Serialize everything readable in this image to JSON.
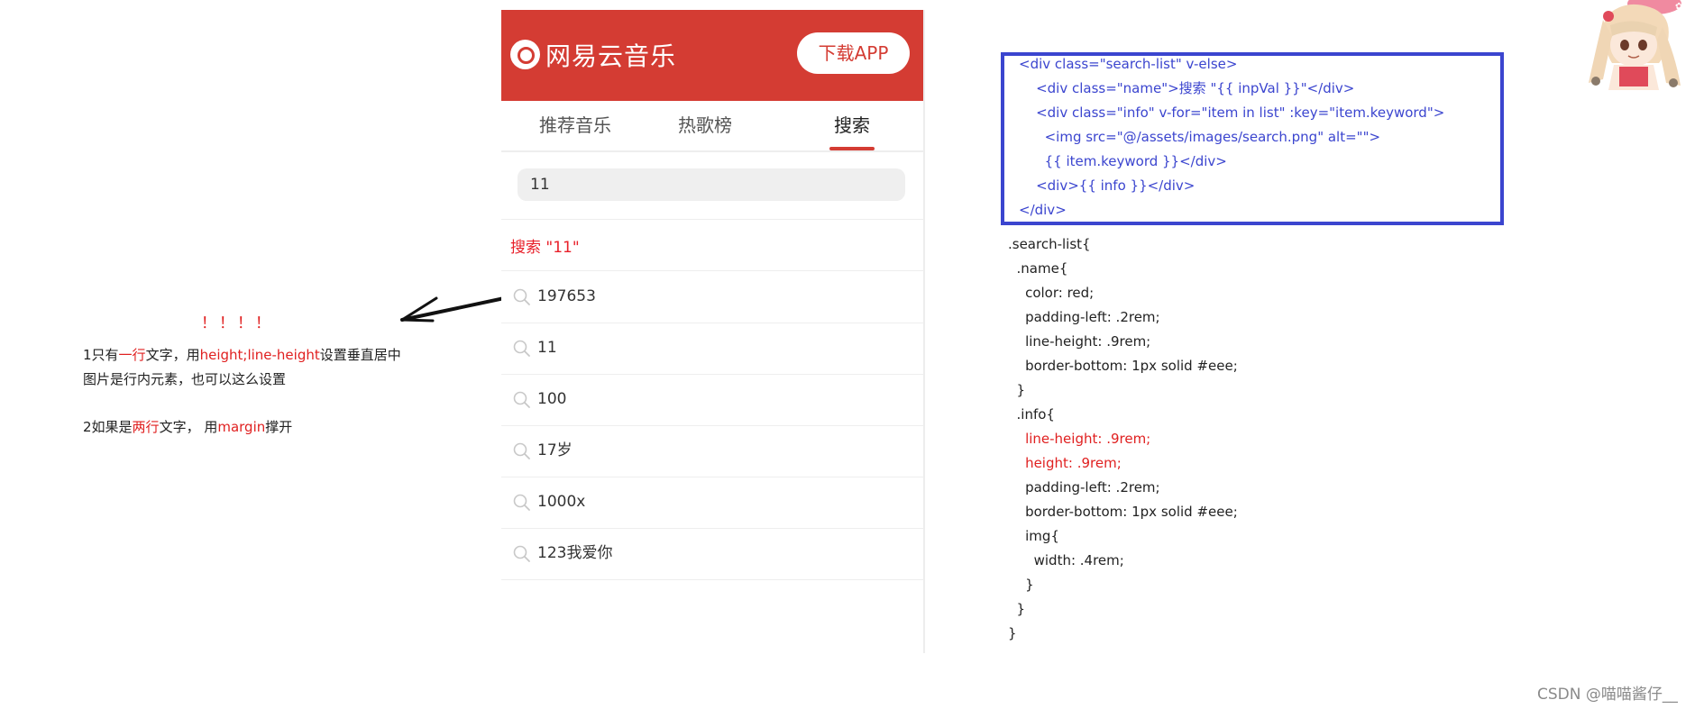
{
  "notes": {
    "exclaim": "！！！！",
    "line1_parts": [
      "1只有",
      "一行",
      "文字，用",
      "height;line-height",
      "设置垂直居中"
    ],
    "line2": "图片是行内元素，也可以这么设置",
    "line3_parts": [
      "2如果是",
      "两行",
      "文字，  用",
      "margin",
      "撑开"
    ]
  },
  "app": {
    "logo_text": "网易云音乐",
    "download_label": "下载APP",
    "tabs": [
      "推荐音乐",
      "热歌榜",
      "搜索"
    ],
    "active_tab": "搜索",
    "search_input_value": "11",
    "search_name": "搜索 \"11\"",
    "results": [
      "197653",
      "11",
      "100",
      "17岁",
      "1000x",
      "123我爱你"
    ]
  },
  "code_template": [
    "<div class=\"search-list\" v-else>",
    "    <div class=\"name\">搜索 \"{{ inpVal }}\"</div>",
    "    <div class=\"info\" v-for=\"item in list\" :key=\"item.keyword\">",
    "      <img src=\"@/assets/images/search.png\" alt=\"\">",
    "      {{ item.keyword }}</div>",
    "    <div>{{ info }}</div>",
    "</div>"
  ],
  "code_style": [
    {
      "text": ".search-list{",
      "color": "black"
    },
    {
      "text": "  .name{",
      "color": "black"
    },
    {
      "text": "    color: red;",
      "color": "black"
    },
    {
      "text": "    padding-left: .2rem;",
      "color": "black"
    },
    {
      "text": "    line-height: .9rem;",
      "color": "black"
    },
    {
      "text": "    border-bottom: 1px solid #eee;",
      "color": "black"
    },
    {
      "text": "  }",
      "color": "black"
    },
    {
      "text": "  .info{",
      "color": "black"
    },
    {
      "text": "    line-height: .9rem;",
      "color": "red"
    },
    {
      "text": "    height: .9rem;",
      "color": "red"
    },
    {
      "text": "    padding-left: .2rem;",
      "color": "black"
    },
    {
      "text": "    border-bottom: 1px solid #eee;",
      "color": "black"
    },
    {
      "text": "    img{",
      "color": "black"
    },
    {
      "text": "      width: .4rem;",
      "color": "black"
    },
    {
      "text": "    }",
      "color": "black"
    },
    {
      "text": "  }",
      "color": "black"
    },
    {
      "text": "}",
      "color": "black"
    }
  ],
  "watermark": "CSDN @喵喵酱仔__",
  "colors": {
    "brand_red": "#d43c33",
    "code_blue": "#3b45cf",
    "note_red": "#e02020"
  }
}
